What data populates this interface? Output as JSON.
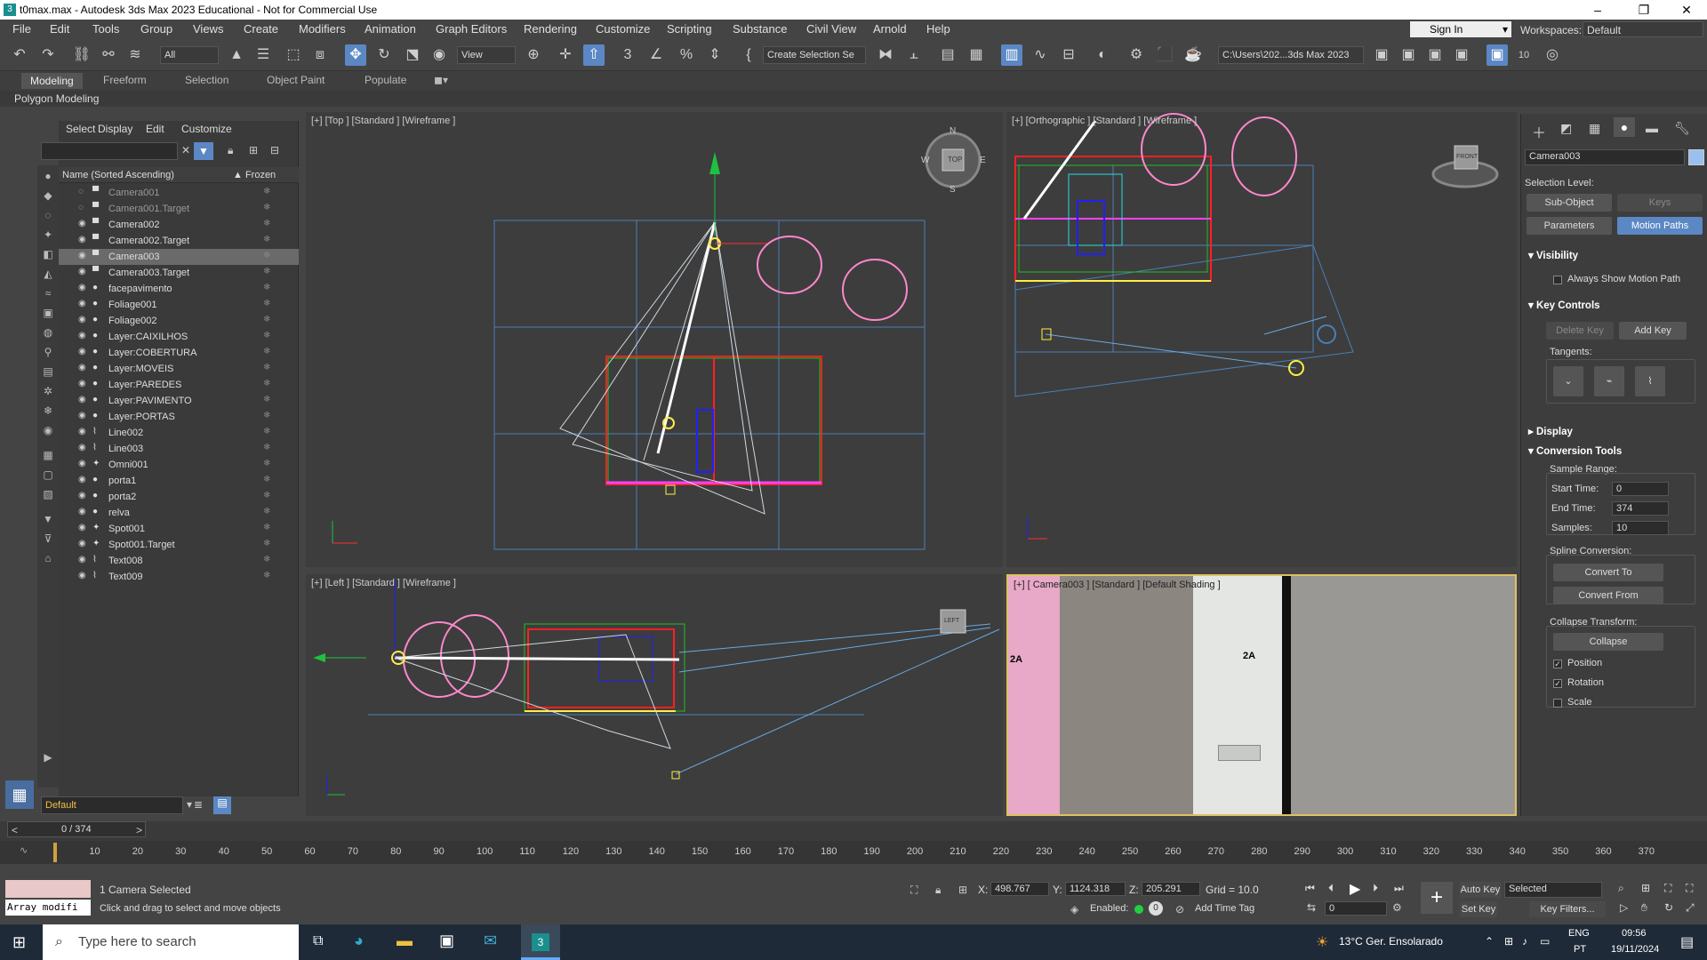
{
  "window": {
    "title": "t0max.max - Autodesk 3ds Max 2023 Educational - Not for Commercial Use"
  },
  "menu": [
    "File",
    "Edit",
    "Tools",
    "Group",
    "Views",
    "Create",
    "Modifiers",
    "Animation",
    "Graph Editors",
    "Rendering",
    "Customize",
    "Scripting",
    "Substance",
    "Civil View",
    "Arnold",
    "Help"
  ],
  "account": {
    "signin": "Sign In",
    "workspaces_label": "Workspaces:",
    "workspace": "Default"
  },
  "toolbar": {
    "filter": "All",
    "refcoord": "View",
    "selset": "Create Selection Se",
    "path": "C:\\Users\\202...3ds Max 2023",
    "snap_num": "3",
    "angle_num": "10"
  },
  "ribbon": {
    "tabs": [
      "Modeling",
      "Freeform",
      "Selection",
      "Object Paint",
      "Populate"
    ],
    "active": "Modeling",
    "sub": "Polygon Modeling"
  },
  "scene_explorer": {
    "tabs": [
      "Select",
      "Display",
      "Edit",
      "Customize"
    ],
    "col_name": "Name (Sorted Ascending)",
    "col_frozen": "▲ Frozen",
    "rows": [
      {
        "name": "Camera001",
        "icon": "cam",
        "dim": true
      },
      {
        "name": "Camera001.Target",
        "icon": "cam",
        "dim": true
      },
      {
        "name": "Camera002",
        "icon": "cam"
      },
      {
        "name": "Camera002.Target",
        "icon": "cam"
      },
      {
        "name": "Camera003",
        "icon": "cam",
        "selected": true
      },
      {
        "name": "Camera003.Target",
        "icon": "cam"
      },
      {
        "name": "facepavimento",
        "icon": "geo"
      },
      {
        "name": "Foliage001",
        "icon": "geo"
      },
      {
        "name": "Foliage002",
        "icon": "geo"
      },
      {
        "name": "Layer:CAIXILHOS",
        "icon": "geo"
      },
      {
        "name": "Layer:COBERTURA",
        "icon": "geo"
      },
      {
        "name": "Layer:MOVEIS",
        "icon": "geo"
      },
      {
        "name": "Layer:PAREDES",
        "icon": "geo"
      },
      {
        "name": "Layer:PAVIMENTO",
        "icon": "geo"
      },
      {
        "name": "Layer:PORTAS",
        "icon": "geo"
      },
      {
        "name": "Line002",
        "icon": "shape"
      },
      {
        "name": "Line003",
        "icon": "shape"
      },
      {
        "name": "Omni001",
        "icon": "light"
      },
      {
        "name": "porta1",
        "icon": "geo"
      },
      {
        "name": "porta2",
        "icon": "geo"
      },
      {
        "name": "relva",
        "icon": "geo"
      },
      {
        "name": "Spot001",
        "icon": "light"
      },
      {
        "name": "Spot001.Target",
        "icon": "light"
      },
      {
        "name": "Text008",
        "icon": "shape"
      },
      {
        "name": "Text009",
        "icon": "shape"
      }
    ],
    "layer": "Default"
  },
  "viewports": {
    "top": "[+] [Top ] [Standard ] [Wireframe ]",
    "ortho": "[+] [Orthographic ] [Standard ] [Wireframe ]",
    "left": "[+] [Left ] [Standard ] [Wireframe ]",
    "camera": "[+] [ Camera003 ] [Standard ] [Default Shading ]",
    "door_label": "2A",
    "viewcube_top": "TOP",
    "viewcube_front": "FRONT",
    "viewcube_left": "LEFT",
    "compass": {
      "n": "N",
      "s": "S",
      "e": "E",
      "w": "W"
    }
  },
  "command_panel": {
    "object_name": "Camera003",
    "selection_level": "Selection Level:",
    "sub_object": "Sub-Object",
    "keys": "Keys",
    "parameters": "Parameters",
    "motion_paths": "Motion Paths",
    "visibility": "Visibility",
    "always_show": "Always Show Motion Path",
    "key_controls": "Key Controls",
    "delete_key": "Delete Key",
    "add_key": "Add Key",
    "tangents": "Tangents:",
    "display": "Display",
    "conversion_tools": "Conversion Tools",
    "sample_range": "Sample Range:",
    "start_time_label": "Start Time:",
    "start_time": "0",
    "end_time_label": "End Time:",
    "end_time": "374",
    "samples_label": "Samples:",
    "samples": "10",
    "spline_conversion": "Spline Conversion:",
    "convert_to": "Convert To",
    "convert_from": "Convert From",
    "collapse_transform": "Collapse Transform:",
    "collapse": "Collapse",
    "position": "Position",
    "rotation": "Rotation",
    "scale": "Scale"
  },
  "timeline": {
    "frame": "0 / 374",
    "ticks": [
      10,
      20,
      30,
      40,
      50,
      60,
      70,
      80,
      90,
      100,
      110,
      120,
      130,
      140,
      150,
      160,
      170,
      180,
      190,
      200,
      210,
      220,
      230,
      240,
      250,
      260,
      270,
      280,
      290,
      300,
      310,
      320,
      330,
      340,
      350,
      360,
      370
    ]
  },
  "status": {
    "maxscript": "Array modifi",
    "selected": "1 Camera Selected",
    "hint": "Click and drag to select and move objects",
    "x_label": "X:",
    "x": "498.767",
    "y_label": "Y:",
    "y": "1124.318",
    "z_label": "Z:",
    "z": "205.291",
    "grid": "Grid = 10.0",
    "enabled": "Enabled:",
    "add_time_tag": "Add Time Tag",
    "auto_key": "Auto Key",
    "set_key": "Set Key",
    "selected_dd": "Selected",
    "key_filters": "Key Filters...",
    "frame_field": "0"
  },
  "taskbar": {
    "search": "Type here to search",
    "weather": "13°C  Ger. Ensolarado",
    "lang": "ENG",
    "region": "PT",
    "time": "09:56",
    "date": "19/11/2024"
  }
}
